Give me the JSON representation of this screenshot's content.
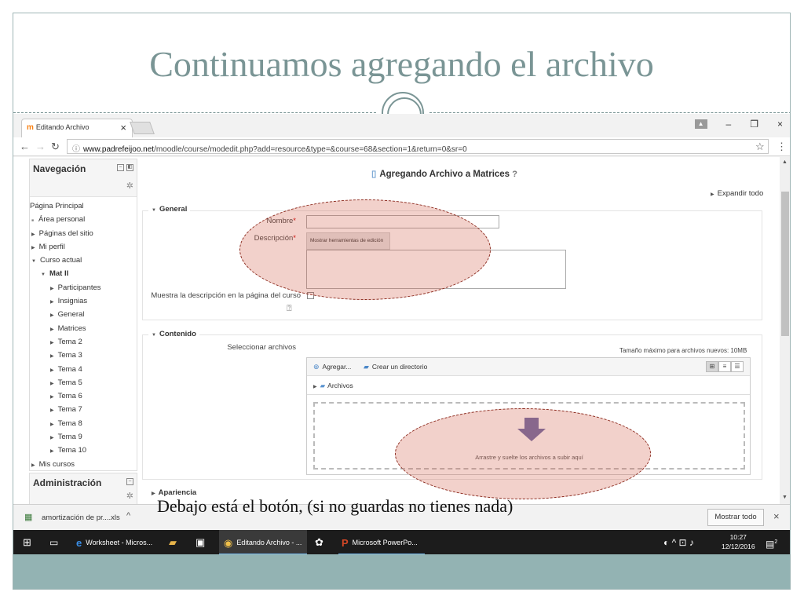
{
  "slide": {
    "title": "Continuamos agregando el archivo",
    "caption": "Debajo está el botón, (si no guardas no tienes nada)"
  },
  "browser": {
    "tab_title": "Editando Archivo",
    "tab_close": "×",
    "url_host": "www.padrefeijoo.net",
    "url_path": "/moodle/course/modedit.php?add=resource&type=&course=68&section=1&return=0&sr=0",
    "window_controls": {
      "minimize": "–",
      "maximize": "❐",
      "close": "×"
    }
  },
  "navigation": {
    "title": "Navegación",
    "items": [
      {
        "label": "Página Principal",
        "style": "none",
        "indent": 0
      },
      {
        "label": "Área personal",
        "style": "sq",
        "indent": 1
      },
      {
        "label": "Páginas del sitio",
        "style": "exp",
        "indent": 1
      },
      {
        "label": "Mi perfil",
        "style": "exp",
        "indent": 1
      },
      {
        "label": "Curso actual",
        "style": "open",
        "indent": 1
      },
      {
        "label": "Mat II",
        "style": "open",
        "indent": 2,
        "bold": true
      },
      {
        "label": "Participantes",
        "style": "exp",
        "indent": 3
      },
      {
        "label": "Insignias",
        "style": "exp",
        "indent": 3
      },
      {
        "label": "General",
        "style": "exp",
        "indent": 3
      },
      {
        "label": "Matrices",
        "style": "exp",
        "indent": 3
      },
      {
        "label": "Tema 2",
        "style": "exp",
        "indent": 3
      },
      {
        "label": "Tema 3",
        "style": "exp",
        "indent": 3
      },
      {
        "label": "Tema 4",
        "style": "exp",
        "indent": 3
      },
      {
        "label": "Tema 5",
        "style": "exp",
        "indent": 3
      },
      {
        "label": "Tema 6",
        "style": "exp",
        "indent": 3
      },
      {
        "label": "Tema 7",
        "style": "exp",
        "indent": 3
      },
      {
        "label": "Tema 8",
        "style": "exp",
        "indent": 3
      },
      {
        "label": "Tema 9",
        "style": "exp",
        "indent": 3
      },
      {
        "label": "Tema 10",
        "style": "exp",
        "indent": 3
      },
      {
        "label": "Mis cursos",
        "style": "exp",
        "indent": 1
      }
    ]
  },
  "administration": {
    "title": "Administración"
  },
  "form": {
    "title": "Agregando Archivo a Matrices",
    "expand_all": "Expandir todo",
    "general_legend": "General",
    "name_label": "Nombre",
    "required_mark": "*",
    "description_label": "Descripción",
    "editor_tools_button": "Mostrar herramientas de edición",
    "show_description_label": "Muestra la descripción en la página del curso",
    "content_legend": "Contenido",
    "select_files_label": "Seleccionar archivos",
    "max_size": "Tamaño máximo para archivos nuevos: 10MB",
    "add_button": "Agregar...",
    "create_dir_button": "Crear un directorio",
    "files_folder": "Archivos",
    "drop_text": "Arrastre y suelte los archivos a subir aquí",
    "appearance_legend": "Apariencia"
  },
  "downloads": {
    "file_name": "amortización de pr....xls",
    "show_all_button": "Mostrar todo",
    "close": "×"
  },
  "taskbar": {
    "items": [
      {
        "label": "Worksheet - Micros...",
        "icon": "edge-icon",
        "glyph": "e"
      },
      {
        "label": "Editando Archivo - ...",
        "icon": "chrome-icon",
        "glyph": "◉"
      },
      {
        "label": "Microsoft PowerPo...",
        "icon": "powerpoint-icon",
        "glyph": "P"
      }
    ],
    "time": "10:27",
    "date": "12/12/2016",
    "notification_count": "2"
  },
  "colors": {
    "title": "#7a9595",
    "accent_ellipse": "#d25a46",
    "taskbar": "#1c1c1c"
  }
}
